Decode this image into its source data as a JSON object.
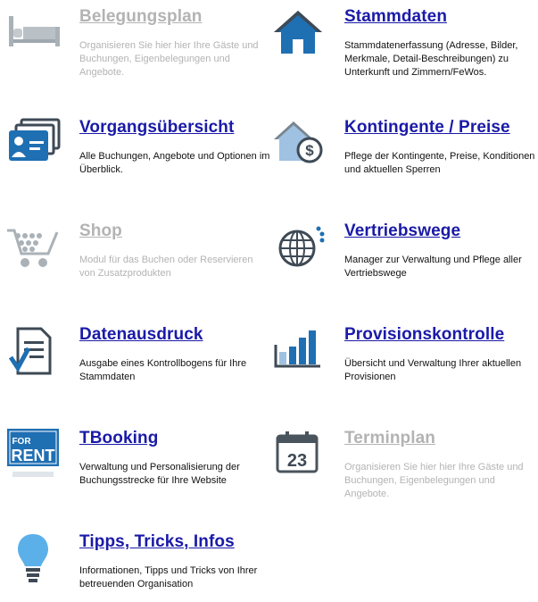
{
  "tiles": [
    {
      "key": "belegungsplan",
      "title": "Belegungsplan",
      "desc": "Organisieren Sie hier hier Ihre Gäste und Buchungen, Eigenbelegungen und Angebote.",
      "active": false,
      "icon": "bed-icon"
    },
    {
      "key": "stammdaten",
      "title": "Stammdaten",
      "desc": "Stammdatenerfassung (Adresse, Bilder, Merkmale, Detail-Beschreibungen) zu Unterkunft und Zimmern/FeWos.",
      "active": true,
      "icon": "house-icon"
    },
    {
      "key": "vorgangsuebersicht",
      "title": "Vorgangsübersicht",
      "desc": "Alle Buchungen, Angebote und Optionen im Überblick.",
      "active": true,
      "icon": "id-cards-icon"
    },
    {
      "key": "kontingente",
      "title": "Kontingente / Preise",
      "desc": "Pflege der Kontingente, Preise, Konditionen und aktuellen Sperren",
      "active": true,
      "icon": "house-dollar-icon"
    },
    {
      "key": "shop",
      "title": "Shop",
      "desc": "Modul für das Buchen oder Reservieren von Zusatzprodukten",
      "active": false,
      "icon": "shopping-cart-icon"
    },
    {
      "key": "vertriebswege",
      "title": "Vertriebswege",
      "desc": "Manager zur Verwaltung und Pflege aller Vertriebswege",
      "active": true,
      "icon": "globe-icon"
    },
    {
      "key": "datenausdruck",
      "title": "Datenausdruck",
      "desc": "Ausgabe eines Kontrollbogens für Ihre Stammdaten",
      "active": true,
      "icon": "checklist-icon"
    },
    {
      "key": "provisionskontrolle",
      "title": "Provisionskontrolle",
      "desc": "Übersicht und Verwaltung Ihrer aktuellen Provisionen",
      "active": true,
      "icon": "bar-chart-icon"
    },
    {
      "key": "tbooking",
      "title": "TBooking",
      "desc": "Verwaltung und Personalisierung der Buchungsstrecke für Ihre Website",
      "active": true,
      "icon": "for-rent-sign-icon",
      "icon_text_top": "FOR",
      "icon_text_bottom": "RENT"
    },
    {
      "key": "terminplan",
      "title": "Terminplan",
      "desc": "Organisieren Sie hier hier Ihre Gäste und Buchungen, Eigenbelegungen und Angebote.",
      "active": false,
      "icon": "calendar-icon",
      "icon_text": "23"
    },
    {
      "key": "tipps",
      "title": "Tipps, Tricks, Infos",
      "desc": "Informationen, Tipps und Tricks von Ihrer betreuenden Organisation",
      "active": true,
      "icon": "lightbulb-icon"
    }
  ],
  "colors": {
    "link": "#1a1aa8",
    "inactive": "#b3b3b3",
    "icon_blue": "#1f6fb3",
    "icon_dark": "#3e4a55"
  }
}
